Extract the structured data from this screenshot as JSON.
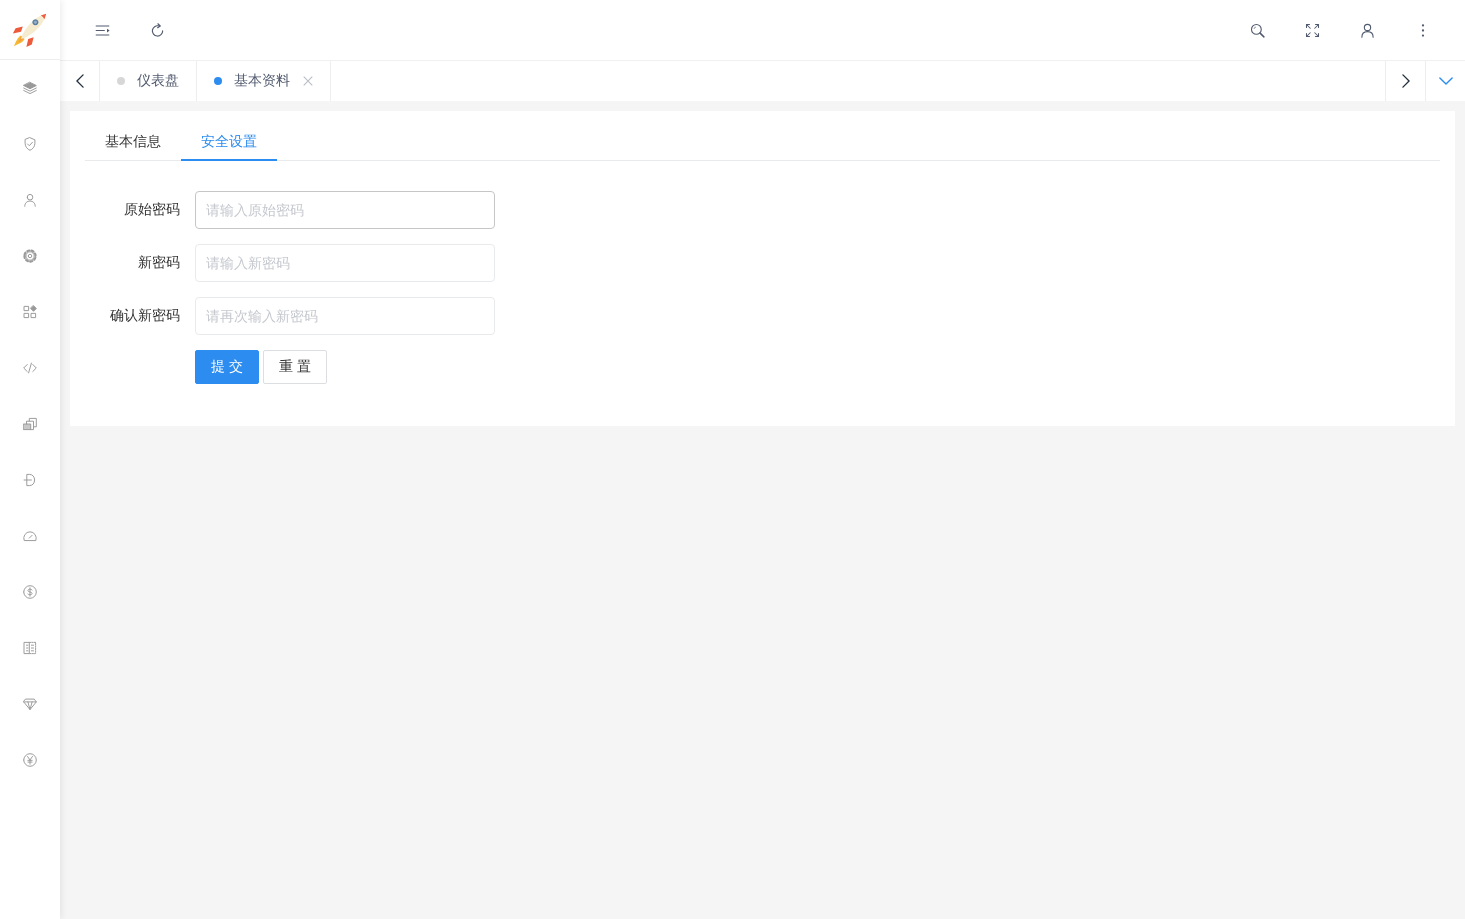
{
  "page_tabs": [
    {
      "label": "仪表盘",
      "selected": false,
      "closable": false
    },
    {
      "label": "基本资料",
      "selected": true,
      "closable": true
    }
  ],
  "card_tabs": [
    {
      "label": "基本信息",
      "selected": false
    },
    {
      "label": "安全设置",
      "selected": true
    }
  ],
  "form": {
    "fields": [
      {
        "label": "原始密码",
        "placeholder": "请输入原始密码",
        "focused": true
      },
      {
        "label": "新密码",
        "placeholder": "请输入新密码",
        "focused": false
      },
      {
        "label": "确认新密码",
        "placeholder": "请再次输入新密码",
        "focused": false
      }
    ],
    "buttons": [
      {
        "label": "提交",
        "kind": "primary"
      },
      {
        "label": "重置",
        "kind": "default"
      }
    ]
  }
}
